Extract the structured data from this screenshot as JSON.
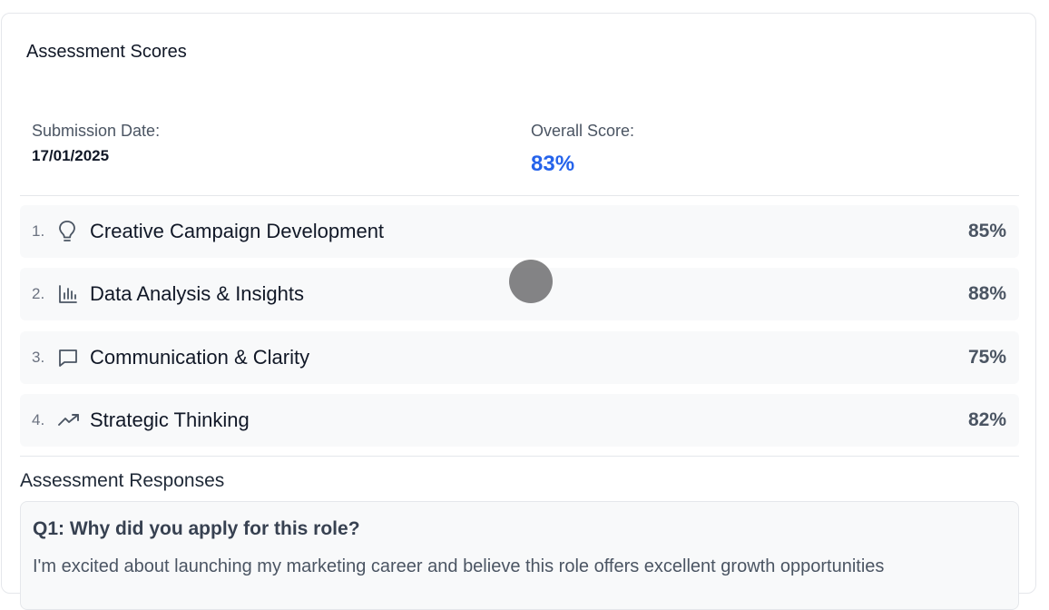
{
  "card": {
    "title": "Assessment Scores"
  },
  "meta": {
    "submission_label": "Submission Date:",
    "submission_value": "17/01/2025",
    "overall_label": "Overall Score:",
    "overall_value": "83%"
  },
  "scores": [
    {
      "num": "1.",
      "icon": "lightbulb-icon",
      "label": "Creative Campaign Development",
      "pct": "85%",
      "value": 0.85
    },
    {
      "num": "2.",
      "icon": "bar-chart-icon",
      "label": "Data Analysis & Insights",
      "pct": "88%",
      "value": 0.88
    },
    {
      "num": "3.",
      "icon": "message-icon",
      "label": "Communication & Clarity",
      "pct": "75%",
      "value": 0.75
    },
    {
      "num": "4.",
      "icon": "trending-up-icon",
      "label": "Strategic Thinking",
      "pct": "82%",
      "value": 0.82
    }
  ],
  "responses": {
    "title": "Assessment Responses",
    "items": [
      {
        "question": "Q1: Why did you apply for this role?",
        "answer": "I'm excited about launching my marketing career and believe this role offers excellent growth opportunities"
      }
    ]
  },
  "colors": {
    "accent": "#2563eb",
    "row_bg": "#f8f9fa",
    "border": "#e5e7eb"
  }
}
